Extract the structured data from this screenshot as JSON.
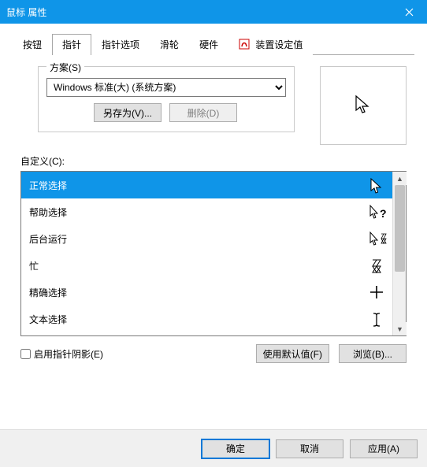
{
  "title": "鼠标 属性",
  "tabs": {
    "t0": "按钮",
    "t1": "指针",
    "t2": "指针选项",
    "t3": "滑轮",
    "t4": "硬件",
    "t5": "装置设定值"
  },
  "scheme": {
    "group_label": "方案(S)",
    "selected": "Windows 标准(大) (系统方案)",
    "saveas": "另存为(V)...",
    "delete": "删除(D)"
  },
  "custom_label": "自定义(C):",
  "list": {
    "i0": "正常选择",
    "i1": "帮助选择",
    "i2": "后台运行",
    "i3": "忙",
    "i4": "精确选择",
    "i5": "文本选择"
  },
  "shadow_checkbox": "启用指针阴影(E)",
  "use_default": "使用默认值(F)",
  "browse": "浏览(B)...",
  "footer": {
    "ok": "确定",
    "cancel": "取消",
    "apply": "应用(A)"
  }
}
